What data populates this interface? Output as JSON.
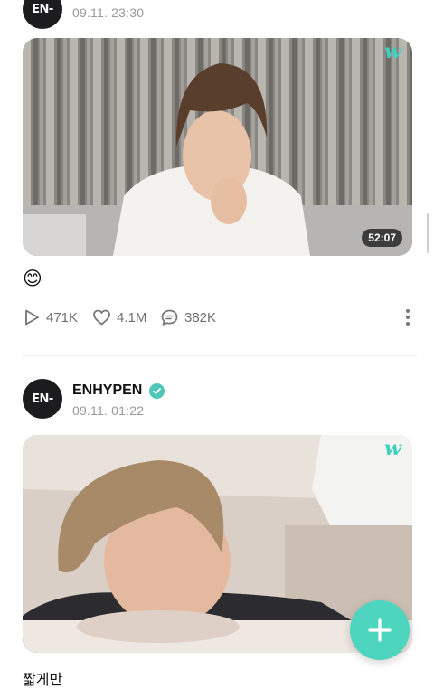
{
  "post1": {
    "avatar_text": "EN-",
    "date": "09.11. 23:30",
    "duration": "52:07",
    "watermark": "w",
    "caption_emoji": "😊",
    "stats": {
      "views": "471K",
      "likes": "4.1M",
      "comments": "382K"
    }
  },
  "post2": {
    "avatar_text": "EN-",
    "author": "ENHYPEN",
    "date": "09.11. 01:22",
    "watermark": "w",
    "caption": "짧게만"
  },
  "colors": {
    "accent": "#4dd5bf",
    "verified": "#4fc6b7"
  },
  "icons": {
    "play": "play-icon",
    "like": "heart-icon",
    "comment": "comment-icon",
    "more": "more-vertical-icon",
    "fab": "plus-icon",
    "verified": "check-icon"
  }
}
